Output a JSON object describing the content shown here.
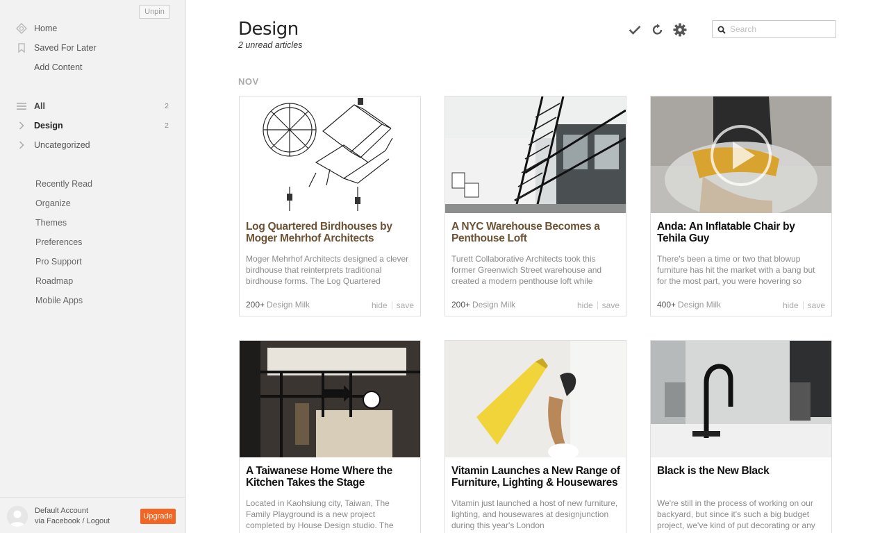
{
  "sidebar": {
    "unpin_label": "Unpin",
    "top_items": [
      {
        "label": "Home",
        "icon": "home-icon"
      },
      {
        "label": "Saved For Later",
        "icon": "bookmark-icon"
      },
      {
        "label": "Add Content"
      }
    ],
    "categories": [
      {
        "label": "All",
        "count": "2",
        "icon": "list-icon"
      },
      {
        "label": "Design",
        "count": "2",
        "icon": "chevron-right-icon"
      },
      {
        "label": "Uncategorized",
        "icon": "chevron-right-icon"
      }
    ],
    "lower_items": [
      {
        "label": "Recently Read"
      },
      {
        "label": "Organize"
      },
      {
        "label": "Themes"
      },
      {
        "label": "Preferences"
      },
      {
        "label": "Pro Support"
      },
      {
        "label": "Roadmap"
      },
      {
        "label": "Mobile Apps"
      }
    ],
    "account": {
      "name": "Default Account",
      "links": "via Facebook / Logout",
      "upgrade_label": "Upgrade"
    }
  },
  "header": {
    "title": "Design",
    "subtitle": "2 unread articles",
    "search_placeholder": "Search"
  },
  "month_label": "NOV",
  "cards": [
    {
      "title": "Log Quartered Birdhouses by Moger Mehrhof Architects",
      "summary": "Moger Mehrhof Architects designed a clever birdhouse that reinterprets traditional birdhouse forms. The Log Quartered",
      "count": "200+",
      "source": "Design Milk",
      "hide": "hide",
      "save": "save"
    },
    {
      "title": "A NYC Warehouse Becomes a Penthouse Loft",
      "summary": "Turett Collaborative Architects took this former Greenwich Street warehouse and created a modern penthouse loft while",
      "count": "200+",
      "source": "Design Milk",
      "hide": "hide",
      "save": "save"
    },
    {
      "title": "Anda: An Inflatable Chair by Tehila Guy",
      "summary": "There's been a time or two that blowup furniture has hit the market with a bang but for the most part, you were hovering so",
      "count": "400+",
      "source": "Design Milk",
      "hide": "hide",
      "save": "save"
    },
    {
      "title": "A Taiwanese Home Where the Kitchen Takes the Stage",
      "summary": "Located in Kaohsiung city, Taiwan, The Family Playground is a new project completed by House Design studio. The"
    },
    {
      "title": "Vitamin Launches a New Range of Furniture, Lighting & Housewares",
      "summary": "Vitamin just launched a host of new furniture, lighting, and housewares at designjunction during this year's London"
    },
    {
      "title": "Black is the New Black",
      "summary": "We're still in the process of working on our backyard, but since it's such a big budget project, we've kind of put decorating or any other house updates on hold. I wish I had"
    }
  ],
  "colors": {
    "accent": "#f26522",
    "read_title": "#6d5234",
    "sidebar_bg": "#f2f2f2"
  }
}
